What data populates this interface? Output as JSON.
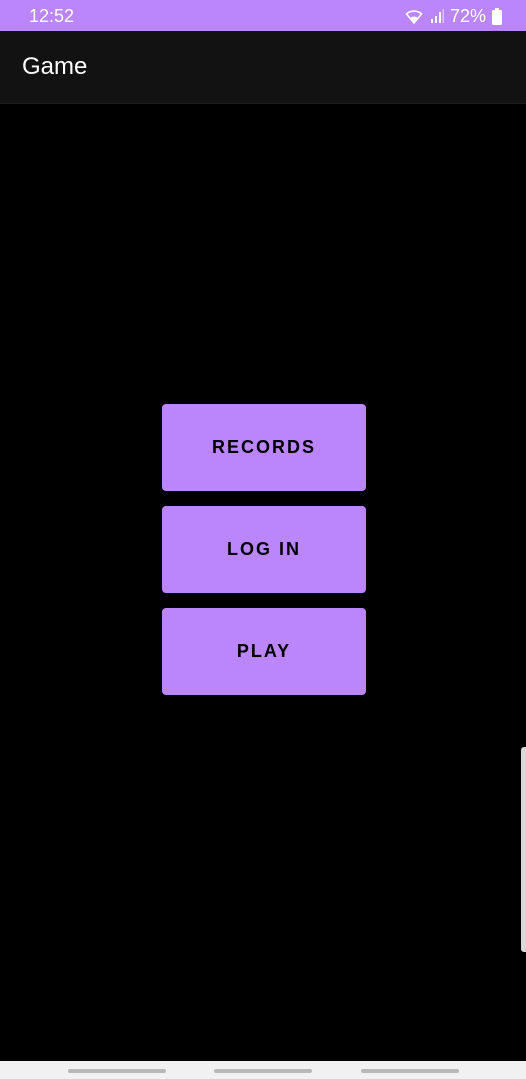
{
  "status_bar": {
    "time": "12:52",
    "battery": "72%",
    "icons": [
      "wifi-icon",
      "signal-icon",
      "battery-icon"
    ],
    "color": "#bb86fc"
  },
  "app_bar": {
    "title": "Game"
  },
  "menu": {
    "records_label": "RECORDS",
    "login_label": "LOG IN",
    "play_label": "PLAY",
    "button_color": "#bb86fc"
  },
  "nav_bar": {
    "buttons": [
      "recent-apps",
      "home",
      "back"
    ]
  }
}
